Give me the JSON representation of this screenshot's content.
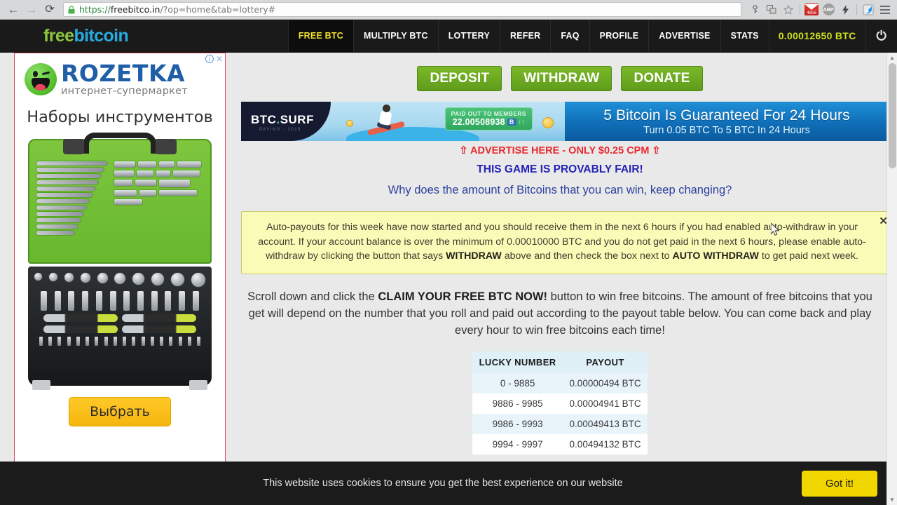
{
  "browser": {
    "back_label": "←",
    "forward_label": "→",
    "reload_label": "⟳",
    "url_scheme": "https://",
    "url_host": "freebitco.in",
    "url_path": "/?op=home&tab=lottery#",
    "url_full": "https://freebitco.in/?op=home&tab=lottery#",
    "icons": {
      "lock": "lock-icon",
      "key": "key-icon",
      "translate": "translate-icon",
      "bookmark": "star-icon",
      "gmail": "gmail-icon",
      "gmail_badge": "4856",
      "adblock": "ABP",
      "lightning": "lightning-icon",
      "extension": "extension-icon",
      "menu": "hamburger-menu-icon"
    }
  },
  "site_header": {
    "logo_part1": "free",
    "logo_part2": "bitcoin",
    "nav": [
      {
        "label": "FREE BTC",
        "active": true
      },
      {
        "label": "MULTIPLY BTC",
        "active": false
      },
      {
        "label": "LOTTERY",
        "active": false
      },
      {
        "label": "REFER",
        "active": false
      },
      {
        "label": "FAQ",
        "active": false
      },
      {
        "label": "PROFILE",
        "active": false
      },
      {
        "label": "ADVERTISE",
        "active": false
      },
      {
        "label": "STATS",
        "active": false
      }
    ],
    "balance": "0.00012650 BTC",
    "logout_icon": "⏻"
  },
  "ad": {
    "brand": "ROZETKA",
    "brand_sub": "интернет-супермаркет",
    "headline": "Наборы инструментов",
    "cta": "Выбрать",
    "adchoices_info": "i",
    "adchoices_close": "✕"
  },
  "main": {
    "action_buttons": [
      "DEPOSIT",
      "WITHDRAW",
      "DONATE"
    ],
    "surf_banner": {
      "logo": "BTC",
      "logo_dot": ".",
      "logo_rest": "SURF",
      "logo_sub": "PAYING - 2016",
      "paid_label": "PAID OUT TO MEMBERS",
      "paid_amount": "22.00508938",
      "paid_unit": "B",
      "paid_arrows": "↑↑",
      "title": "5 Bitcoin Is Guaranteed For 24 Hours",
      "subtitle": "Turn 0.05 BTC To 5 BTC In 24 Hours"
    },
    "advertise_line": "⇧ ADVERTISE HERE - ONLY $0.25 CPM ⇧",
    "provably_fair": "THIS GAME IS PROVABLY FAIR!",
    "why_link": "Why does the amount of Bitcoins that you can win, keep changing?",
    "notice": {
      "part1": "Auto-payouts for this week have now started and you should receive them in the next 6 hours if you had enabled auto-withdraw in your account. If your account balance is over the minimum of 0.00010000 BTC and you do not get paid in the next 6 hours, please enable auto-withdraw by clicking the button that says ",
      "bold1": "WITHDRAW",
      "part2": " above and then check the box next to ",
      "bold2": "AUTO WITHDRAW",
      "part3": " to get paid next week.",
      "close": "✕"
    },
    "instructions": {
      "part1": "Scroll down and click the ",
      "bold1": "CLAIM YOUR FREE BTC NOW!",
      "part2": " button to win free bitcoins. The amount of free bitcoins that you get will depend on the number that you roll and paid out according to the payout table below. You can come back and play every hour to win free bitcoins each time!"
    },
    "payout_table": {
      "headers": [
        "LUCKY NUMBER",
        "PAYOUT"
      ],
      "rows": [
        [
          "0 - 9885",
          "0.00000494 BTC"
        ],
        [
          "9886 - 9985",
          "0.00004941 BTC"
        ],
        [
          "9986 - 9993",
          "0.00049413 BTC"
        ],
        [
          "9994 - 9997",
          "0.00494132 BTC"
        ]
      ]
    }
  },
  "cookie_bar": {
    "text": "This website uses cookies to ensure you get the best experience on our website",
    "button": "Got it!"
  },
  "scrollbar": {
    "up": "▲",
    "down": "▼"
  },
  "colors": {
    "accent_green": "#8cc63f",
    "accent_blue": "#29abe2",
    "balance_yellow": "#cde01f",
    "button_green": "#7cb828",
    "notice_bg": "#fbfbb8",
    "cookie_yellow": "#f2d600",
    "ad_border": "#d14a5a"
  }
}
